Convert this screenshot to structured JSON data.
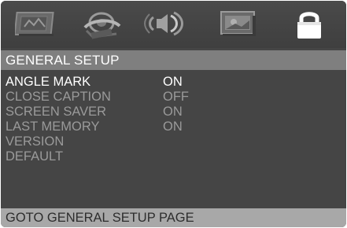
{
  "tabs": [
    {
      "icon": "general-setup-icon",
      "selected": false
    },
    {
      "icon": "video-setup-icon",
      "selected": false
    },
    {
      "icon": "audio-setup-icon",
      "selected": false
    },
    {
      "icon": "picture-setup-icon",
      "selected": false
    },
    {
      "icon": "lock-icon",
      "selected": true
    }
  ],
  "header": {
    "title": "GENERAL SETUP"
  },
  "menu": [
    {
      "label": "ANGLE MARK",
      "value": "ON",
      "state": "active"
    },
    {
      "label": "CLOSE CAPTION",
      "value": "OFF",
      "state": "inactive"
    },
    {
      "label": "SCREEN SAVER",
      "value": "ON",
      "state": "inactive"
    },
    {
      "label": "LAST MEMORY",
      "value": "ON",
      "state": "inactive"
    },
    {
      "label": "VERSION",
      "value": "",
      "state": "inactive"
    },
    {
      "label": "DEFAULT",
      "value": "",
      "state": "inactive"
    }
  ],
  "footer": {
    "text": "GOTO GENERAL SETUP PAGE"
  },
  "colors": {
    "panel": "#454545",
    "header": "#7f7f7f",
    "footer": "#a8a8a8",
    "active_text": "#ffffff",
    "inactive_text": "#9a9a9a"
  }
}
